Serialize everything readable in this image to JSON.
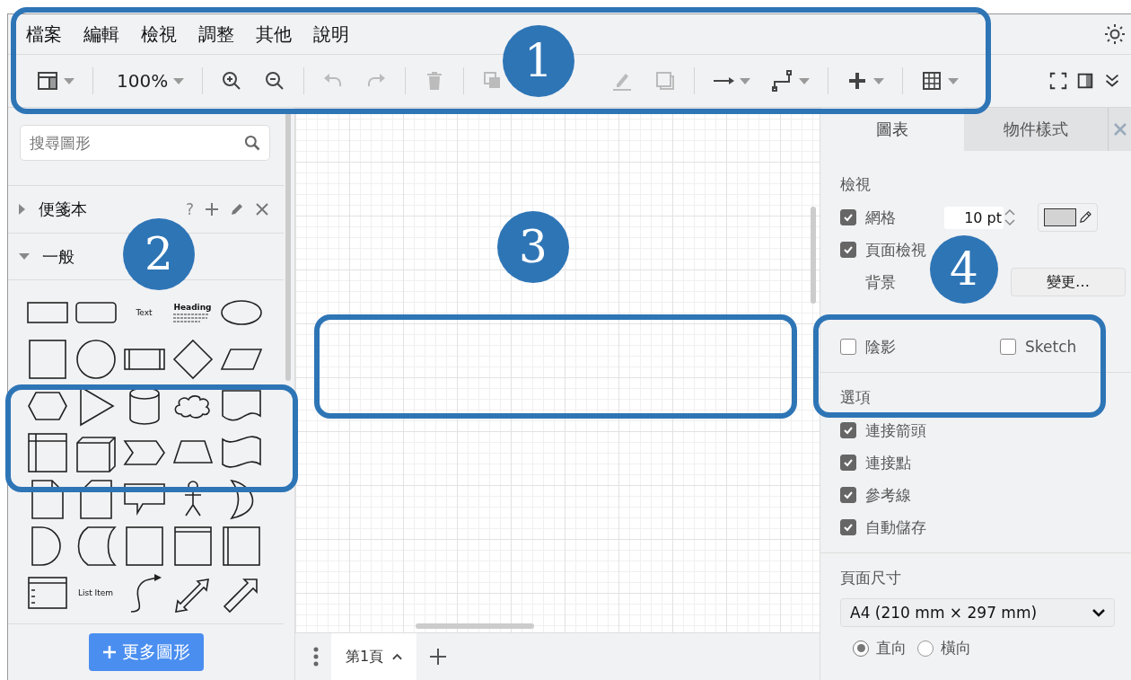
{
  "menu": [
    "檔案",
    "編輯",
    "檢視",
    "調整",
    "其他",
    "說明"
  ],
  "toolbar": {
    "tools": [
      {
        "kind": "layout",
        "disabled": false,
        "dropdown": true
      },
      {
        "kind": "sep"
      },
      {
        "kind": "zoom",
        "label": "100%",
        "disabled": false,
        "dropdown": true
      },
      {
        "kind": "sep"
      },
      {
        "kind": "zoom-in",
        "disabled": false,
        "dropdown": false
      },
      {
        "kind": "zoom-out",
        "disabled": false,
        "dropdown": false
      },
      {
        "kind": "sep"
      },
      {
        "kind": "undo",
        "disabled": true,
        "dropdown": false
      },
      {
        "kind": "redo",
        "disabled": true,
        "dropdown": false
      },
      {
        "kind": "sep"
      },
      {
        "kind": "delete",
        "disabled": true,
        "dropdown": false
      },
      {
        "kind": "sep"
      },
      {
        "kind": "to-front",
        "disabled": true,
        "dropdown": false
      },
      {
        "kind": "line",
        "disabled": true,
        "dropdown": false
      },
      {
        "kind": "shadow",
        "disabled": true,
        "dropdown": false
      },
      {
        "kind": "sep"
      },
      {
        "kind": "connection",
        "disabled": false,
        "dropdown": true
      },
      {
        "kind": "waypoint",
        "disabled": false,
        "dropdown": true
      },
      {
        "kind": "sep"
      },
      {
        "kind": "insert",
        "disabled": false,
        "dropdown": true
      },
      {
        "kind": "sep"
      },
      {
        "kind": "table",
        "disabled": false,
        "dropdown": true
      }
    ],
    "right_tools": [
      {
        "kind": "fullscreen"
      },
      {
        "kind": "panel"
      },
      {
        "kind": "collapse"
      }
    ]
  },
  "sidebar": {
    "search": {
      "placeholder": "搜尋圖形"
    },
    "sections": [
      {
        "label": "便箋本",
        "expanded": false,
        "help": "?"
      },
      {
        "label": "一般",
        "expanded": true
      }
    ],
    "shapes": [
      {
        "kind": "rect"
      },
      {
        "kind": "rounded"
      },
      {
        "kind": "text",
        "label": "Text"
      },
      {
        "kind": "heading",
        "label": "Heading"
      },
      {
        "kind": "ellipse"
      },
      {
        "kind": "square"
      },
      {
        "kind": "circle"
      },
      {
        "kind": "process"
      },
      {
        "kind": "diamond"
      },
      {
        "kind": "parallelogram"
      },
      {
        "kind": "hexagon"
      },
      {
        "kind": "triangle"
      },
      {
        "kind": "cylinder"
      },
      {
        "kind": "cloud"
      },
      {
        "kind": "document"
      },
      {
        "kind": "storage"
      },
      {
        "kind": "cube"
      },
      {
        "kind": "step"
      },
      {
        "kind": "trapezoid"
      },
      {
        "kind": "tape"
      },
      {
        "kind": "note"
      },
      {
        "kind": "card"
      },
      {
        "kind": "callout"
      },
      {
        "kind": "actor"
      },
      {
        "kind": "or"
      },
      {
        "kind": "and"
      },
      {
        "kind": "datastore"
      },
      {
        "kind": "square"
      },
      {
        "kind": "frame-top"
      },
      {
        "kind": "frame-left"
      },
      {
        "kind": "list"
      },
      {
        "kind": "text",
        "label": "List Item"
      },
      {
        "kind": "curve"
      },
      {
        "kind": "bidir"
      },
      {
        "kind": "arrow"
      }
    ],
    "more_button": "更多圖形"
  },
  "page_tab": {
    "label": "第1頁",
    "selected": true
  },
  "panel": {
    "tabs": [
      {
        "label": "圖表",
        "selected": true
      },
      {
        "label": "物件樣式",
        "selected": false
      }
    ],
    "view_title": "檢視",
    "grid": {
      "label": "網格",
      "checked": true,
      "size": "10 pt"
    },
    "page_view": {
      "label": "頁面檢視",
      "checked": true
    },
    "background": {
      "label": "背景",
      "button": "變更…"
    },
    "shadow": {
      "label": "陰影",
      "checked": false
    },
    "sketch": {
      "label": "Sketch",
      "checked": false
    },
    "options_title": "選項",
    "options": [
      {
        "label": "連接箭頭",
        "checked": true
      },
      {
        "label": "連接點",
        "checked": true
      },
      {
        "label": "參考線",
        "checked": true
      },
      {
        "label": "自動儲存",
        "checked": true
      }
    ],
    "paper_title": "頁面尺寸",
    "paper_size": "A4 (210 mm × 297 mm)",
    "orientations": [
      {
        "label": "直向",
        "selected": true
      },
      {
        "label": "橫向",
        "selected": false
      }
    ]
  },
  "annotations": [
    {
      "number": "1"
    },
    {
      "number": "2"
    },
    {
      "number": "3"
    },
    {
      "number": "4"
    }
  ]
}
